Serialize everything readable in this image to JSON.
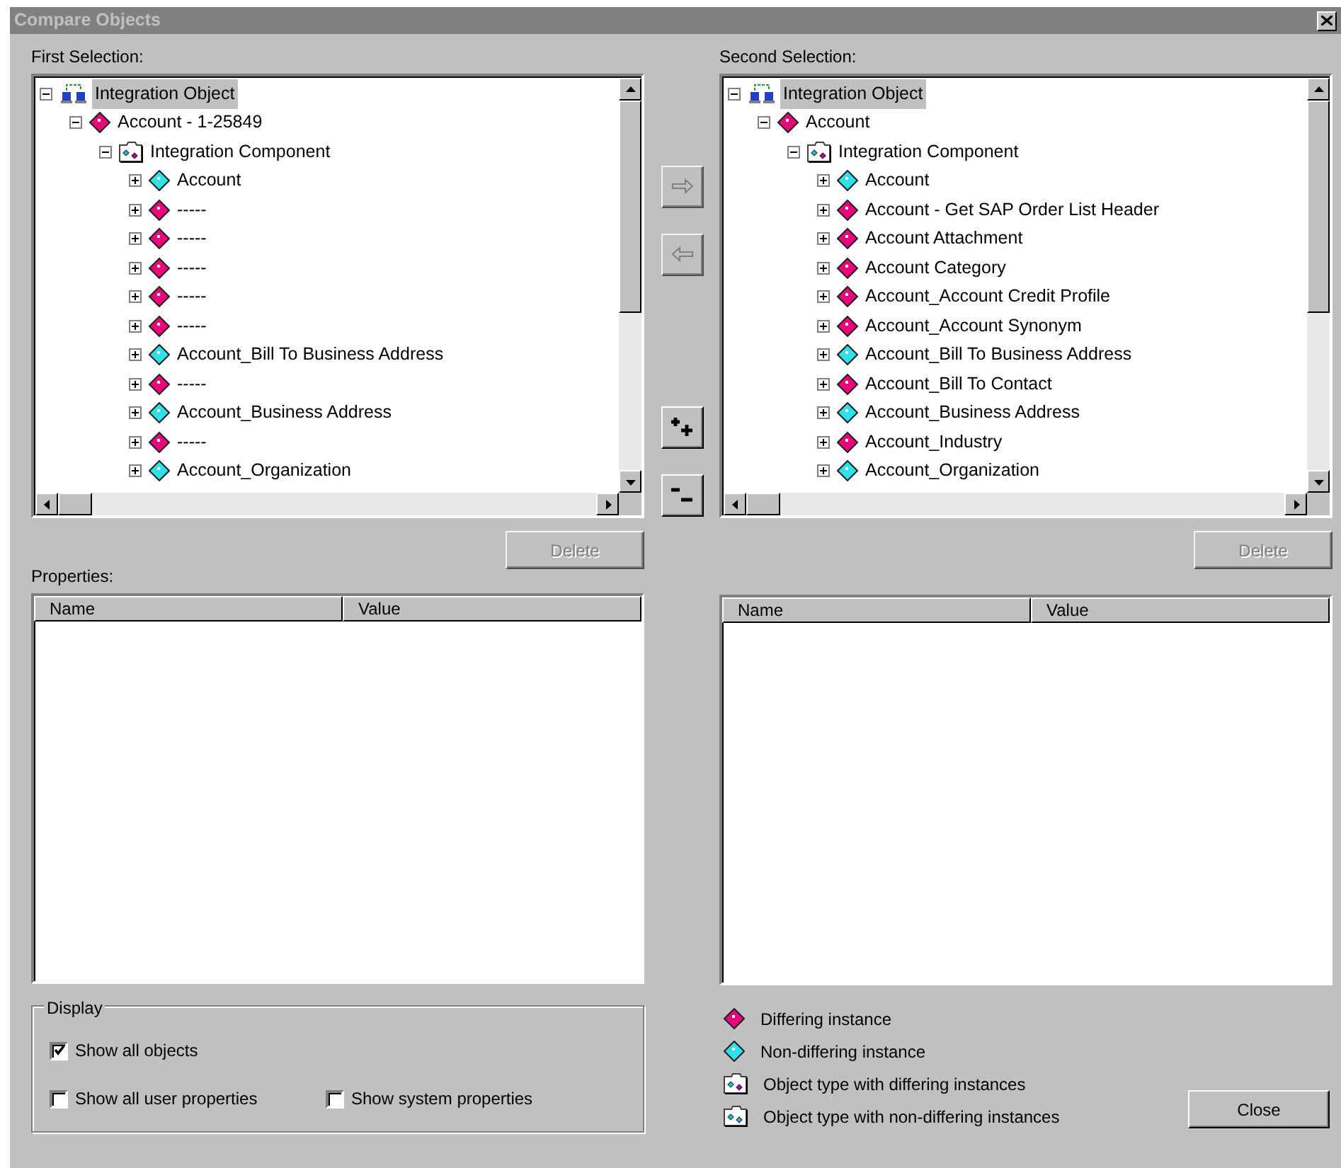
{
  "window": {
    "title": "Compare Objects"
  },
  "first_selection": {
    "label": "First Selection:",
    "tree": [
      {
        "kind": "object",
        "label": "Integration Object",
        "expanded": true,
        "selected": true,
        "children": [
          {
            "kind": "instance",
            "differing": true,
            "label": "Account - 1-25849",
            "expanded": true,
            "selected": false,
            "children": [
              {
                "kind": "component",
                "differing": true,
                "label": "Integration Component",
                "expanded": true,
                "selected": false,
                "children": [
                  {
                    "kind": "instance",
                    "differing": false,
                    "label": "Account",
                    "expanded": false,
                    "selected": false
                  },
                  {
                    "kind": "instance",
                    "differing": true,
                    "label": "-----",
                    "expanded": false,
                    "selected": false
                  },
                  {
                    "kind": "instance",
                    "differing": true,
                    "label": "-----",
                    "expanded": false,
                    "selected": false
                  },
                  {
                    "kind": "instance",
                    "differing": true,
                    "label": "-----",
                    "expanded": false,
                    "selected": false
                  },
                  {
                    "kind": "instance",
                    "differing": true,
                    "label": "-----",
                    "expanded": false,
                    "selected": false
                  },
                  {
                    "kind": "instance",
                    "differing": true,
                    "label": "-----",
                    "expanded": false,
                    "selected": false
                  },
                  {
                    "kind": "instance",
                    "differing": false,
                    "label": "Account_Bill To Business Address",
                    "expanded": false,
                    "selected": false
                  },
                  {
                    "kind": "instance",
                    "differing": true,
                    "label": "-----",
                    "expanded": false,
                    "selected": false
                  },
                  {
                    "kind": "instance",
                    "differing": false,
                    "label": "Account_Business Address",
                    "expanded": false,
                    "selected": false
                  },
                  {
                    "kind": "instance",
                    "differing": true,
                    "label": "-----",
                    "expanded": false,
                    "selected": false
                  },
                  {
                    "kind": "instance",
                    "differing": false,
                    "label": "Account_Organization",
                    "expanded": false,
                    "selected": false
                  }
                ]
              }
            ]
          }
        ]
      }
    ],
    "delete_button": {
      "label": "Delete",
      "disabled": true
    }
  },
  "second_selection": {
    "label": "Second Selection:",
    "tree": [
      {
        "kind": "object",
        "label": "Integration Object",
        "expanded": true,
        "selected": true,
        "children": [
          {
            "kind": "instance",
            "differing": true,
            "label": "Account",
            "expanded": true,
            "selected": false,
            "children": [
              {
                "kind": "component",
                "differing": true,
                "label": "Integration Component",
                "expanded": true,
                "selected": false,
                "children": [
                  {
                    "kind": "instance",
                    "differing": false,
                    "label": "Account",
                    "expanded": false,
                    "selected": false
                  },
                  {
                    "kind": "instance",
                    "differing": true,
                    "label": "Account - Get SAP Order List Header",
                    "expanded": false,
                    "selected": false
                  },
                  {
                    "kind": "instance",
                    "differing": true,
                    "label": "Account Attachment",
                    "expanded": false,
                    "selected": false
                  },
                  {
                    "kind": "instance",
                    "differing": true,
                    "label": "Account Category",
                    "expanded": false,
                    "selected": false
                  },
                  {
                    "kind": "instance",
                    "differing": true,
                    "label": "Account_Account Credit Profile",
                    "expanded": false,
                    "selected": false
                  },
                  {
                    "kind": "instance",
                    "differing": true,
                    "label": "Account_Account Synonym",
                    "expanded": false,
                    "selected": false
                  },
                  {
                    "kind": "instance",
                    "differing": false,
                    "label": "Account_Bill To Business Address",
                    "expanded": false,
                    "selected": false
                  },
                  {
                    "kind": "instance",
                    "differing": true,
                    "label": "Account_Bill To Contact",
                    "expanded": false,
                    "selected": false
                  },
                  {
                    "kind": "instance",
                    "differing": false,
                    "label": "Account_Business Address",
                    "expanded": false,
                    "selected": false
                  },
                  {
                    "kind": "instance",
                    "differing": true,
                    "label": "Account_Industry",
                    "expanded": false,
                    "selected": false
                  },
                  {
                    "kind": "instance",
                    "differing": false,
                    "label": "Account_Organization",
                    "expanded": false,
                    "selected": false
                  }
                ]
              }
            ]
          }
        ]
      }
    ],
    "delete_button": {
      "label": "Delete",
      "disabled": true
    }
  },
  "transfer_buttons": [
    {
      "kind": "copy-right",
      "disabled": true
    },
    {
      "kind": "copy-left",
      "disabled": true
    },
    {
      "kind": "expand-all",
      "disabled": false
    },
    {
      "kind": "collapse-all",
      "disabled": false
    }
  ],
  "properties": {
    "label": "Properties:",
    "columns": [
      "Name",
      "Value"
    ]
  },
  "second_properties": {
    "columns": [
      "Name",
      "Value"
    ]
  },
  "display": {
    "title": "Display",
    "options": [
      {
        "label": "Show all objects",
        "checked": true
      },
      {
        "label": "Show all user properties",
        "checked": false
      },
      {
        "label": "Show system properties",
        "checked": false
      }
    ]
  },
  "legend": [
    {
      "kind": "instance",
      "differing": true,
      "label": "Differing instance"
    },
    {
      "kind": "instance",
      "differing": false,
      "label": "Non-differing instance"
    },
    {
      "kind": "component",
      "differing": true,
      "label": "Object type with differing instances"
    },
    {
      "kind": "component",
      "differing": false,
      "label": "Object type with non-differing instances"
    }
  ],
  "close_button": {
    "label": "Close",
    "disabled": false
  }
}
